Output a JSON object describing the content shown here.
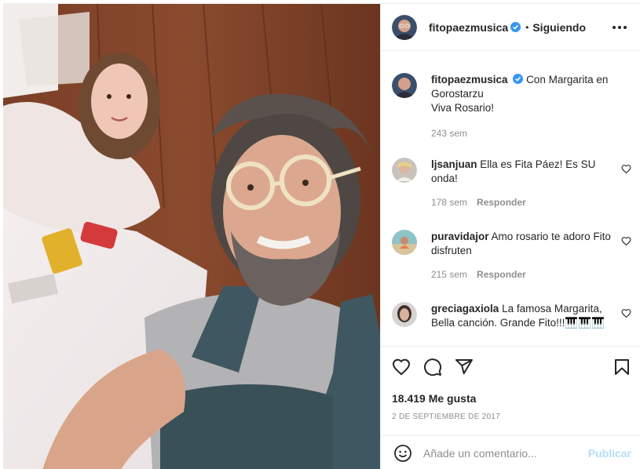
{
  "post": {
    "username": "fitopaezmusica",
    "follow_status": "Siguiendo",
    "separator": "•",
    "caption_line1": "Con Margarita en Gorostarzu",
    "caption_line2": "Viva Rosario!",
    "caption_time": "243 sem",
    "likes_text": "18.419 Me gusta",
    "date_text": "2 de septiembre de 2017"
  },
  "comments": [
    {
      "username": "ljsanjuan",
      "text": "Ella es Fita Páez! Es SU onda!",
      "time": "178 sem",
      "reply_label": "Responder"
    },
    {
      "username": "puravidajor",
      "text": "Amo rosario te adoro Fito disfruten",
      "time": "215 sem",
      "reply_label": "Responder"
    },
    {
      "username": "greciagaxiola",
      "text": "La famosa Margarita, Bella canción. Grande Fito!!!🎹🎹🎹",
      "time": "",
      "reply_label": ""
    }
  ],
  "composer": {
    "placeholder": "Añade un comentario...",
    "publish_label": "Publicar"
  },
  "icons": {
    "verified": "verified-badge-icon",
    "more": "more-options-icon",
    "like": "heart-icon",
    "comment": "comment-icon",
    "share": "share-icon",
    "save": "bookmark-icon",
    "emoji": "emoji-icon"
  },
  "colors": {
    "verified_blue": "#3897f0",
    "publish_disabled": "#b2dffc",
    "muted_text": "#8e8e8e",
    "primary_text": "#262626"
  }
}
